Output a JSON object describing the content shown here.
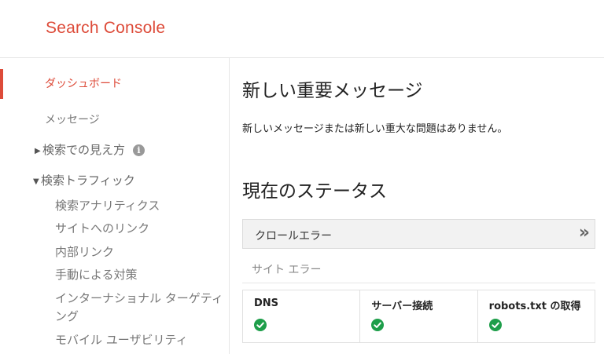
{
  "header": {
    "brand": "Search Console"
  },
  "sidebar": {
    "items": [
      {
        "label": "ダッシュボード"
      },
      {
        "label": "メッセージ"
      },
      {
        "label": "検索での見え方"
      },
      {
        "label": "検索トラフィック"
      }
    ],
    "subitems": [
      {
        "label": "検索アナリティクス"
      },
      {
        "label": "サイトへのリンク"
      },
      {
        "label": "内部リンク"
      },
      {
        "label": "手動による対策"
      },
      {
        "label": "インターナショナル ターゲティ"
      },
      {
        "label": "ング"
      },
      {
        "label": "モバイル ユーザビリティ"
      }
    ],
    "icons": {
      "collapsed": "triangle-right-icon",
      "expanded": "triangle-down-icon",
      "info": "info-icon"
    }
  },
  "main": {
    "new_messages_title": "新しい重要メッセージ",
    "new_messages_text": "新しいメッセージまたは新しい重大な問題はありません。",
    "status_title": "現在のステータス",
    "crawl_errors": {
      "title": "クロールエラー",
      "site_errors_label": "サイト エラー",
      "cells": [
        {
          "label": "DNS",
          "status": "ok"
        },
        {
          "label": "サーバー接続",
          "status": "ok"
        },
        {
          "label": "robots.txt の取得",
          "status": "ok"
        }
      ]
    }
  },
  "colors": {
    "brand": "#dd4b39",
    "ok": "#1e9e4a"
  }
}
